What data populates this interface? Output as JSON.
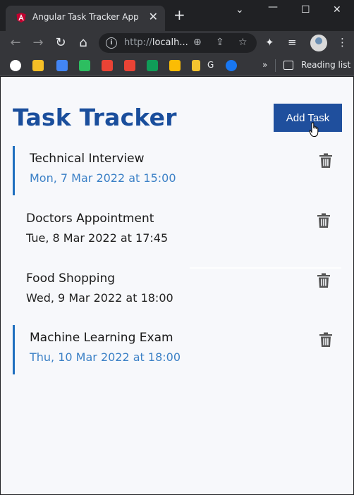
{
  "browser": {
    "tab_title": "Angular Task Tracker App",
    "url_prefix": "http://",
    "url_host": "localh...",
    "reading_list_label": "Reading list",
    "bookmark_g_label": "G",
    "bookmarks_overflow": "»"
  },
  "app": {
    "title": "Task Tracker",
    "add_button_label": "Add Task",
    "brand_color": "#1f4f9d",
    "reminder_color": "#3b80c6"
  },
  "tasks": [
    {
      "name": "Technical Interview",
      "date": "Mon, 7 Mar 2022 at 15:00",
      "reminder": true
    },
    {
      "name": "Doctors Appointment",
      "date": "Tue, 8 Mar 2022 at 17:45",
      "reminder": false
    },
    {
      "name": "Food Shopping",
      "date": "Wed, 9 Mar 2022 at 18:00",
      "reminder": false
    },
    {
      "name": "Machine Learning Exam",
      "date": "Thu, 10 Mar 2022 at 18:00",
      "reminder": true
    }
  ]
}
